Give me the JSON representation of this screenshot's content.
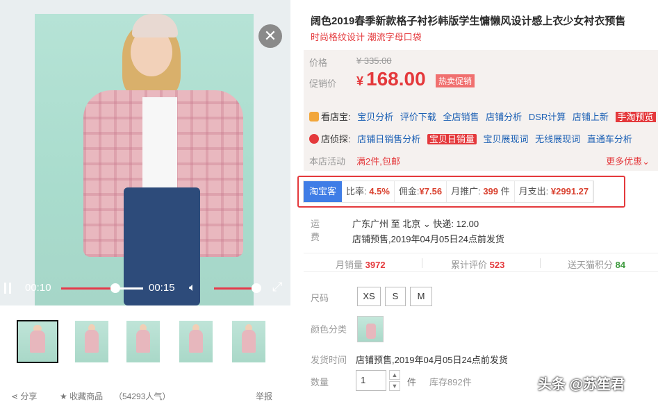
{
  "video": {
    "current_time": "00:10",
    "total_time": "00:15",
    "progress": 0.66,
    "volume": 0.9
  },
  "thumbnails": [
    {
      "label": "image-1"
    },
    {
      "label": "image-2"
    },
    {
      "label": "image-3"
    },
    {
      "label": "image-4"
    },
    {
      "label": "image-5"
    }
  ],
  "footer": {
    "share": "分享",
    "favorite": "收藏商品",
    "popularity": "（54293人气）",
    "report": "举报"
  },
  "product": {
    "title": "阔色2019春季新款格子衬衫韩版学生慵懒风设计感上衣少女衬衣预售",
    "subtitle": "时尚格纹设计 潮流字母口袋"
  },
  "price": {
    "orig_label": "价格",
    "orig_value": "¥ 335.00",
    "promo_label": "促销价",
    "promo_currency": "¥",
    "promo_value": "168.00",
    "badge": "热卖促销"
  },
  "tools": {
    "row1_label": "看店宝:",
    "row1_links": [
      "宝贝分析",
      "评价下载",
      "全店销售",
      "店铺分析",
      "DSR计算",
      "店铺上新"
    ],
    "row1_highlight": "手淘预览",
    "row2_label": "店侦探:",
    "row2_link1": "店铺日销售分析",
    "row2_highlight": "宝贝日销量",
    "row2_links": [
      "宝贝展现词",
      "无线展现词",
      "直通车分析"
    ]
  },
  "activity": {
    "label": "本店活动",
    "value": "满2件,包邮",
    "more": "更多优惠"
  },
  "taobaoke": {
    "tag": "淘宝客",
    "rate_label": "比率:",
    "rate": "4.5%",
    "commission_label": "佣金:",
    "commission": "¥7.56",
    "monthly_promo_label": "月推广:",
    "monthly_promo": "399",
    "monthly_promo_unit": "件",
    "monthly_spend_label": "月支出:",
    "monthly_spend": "¥2991.27"
  },
  "shipping": {
    "label": "运费",
    "line1": "广东广州 至 北京 ⌄ 快递: 12.00",
    "line2": "店铺预售,2019年04月05日24点前发货"
  },
  "stats": {
    "monthly_sales_label": "月销量",
    "monthly_sales": "3972",
    "reviews_label": "累计评价",
    "reviews": "523",
    "points_label": "送天猫积分",
    "points": "84"
  },
  "options": {
    "size_label": "尺码",
    "sizes": [
      "XS",
      "S",
      "M"
    ],
    "color_label": "颜色分类",
    "ship_time_label": "发货时间",
    "ship_time": "店铺预售,2019年04月05日24点前发货",
    "qty_label": "数量",
    "qty_value": "1",
    "qty_unit": "件",
    "stock": "库存892件"
  },
  "watermark": "头条 @苏笙君",
  "colors": {
    "accent_red": "#e4393c",
    "tbk_blue": "#3f7de6",
    "price_bg": "#f5f1ef"
  }
}
